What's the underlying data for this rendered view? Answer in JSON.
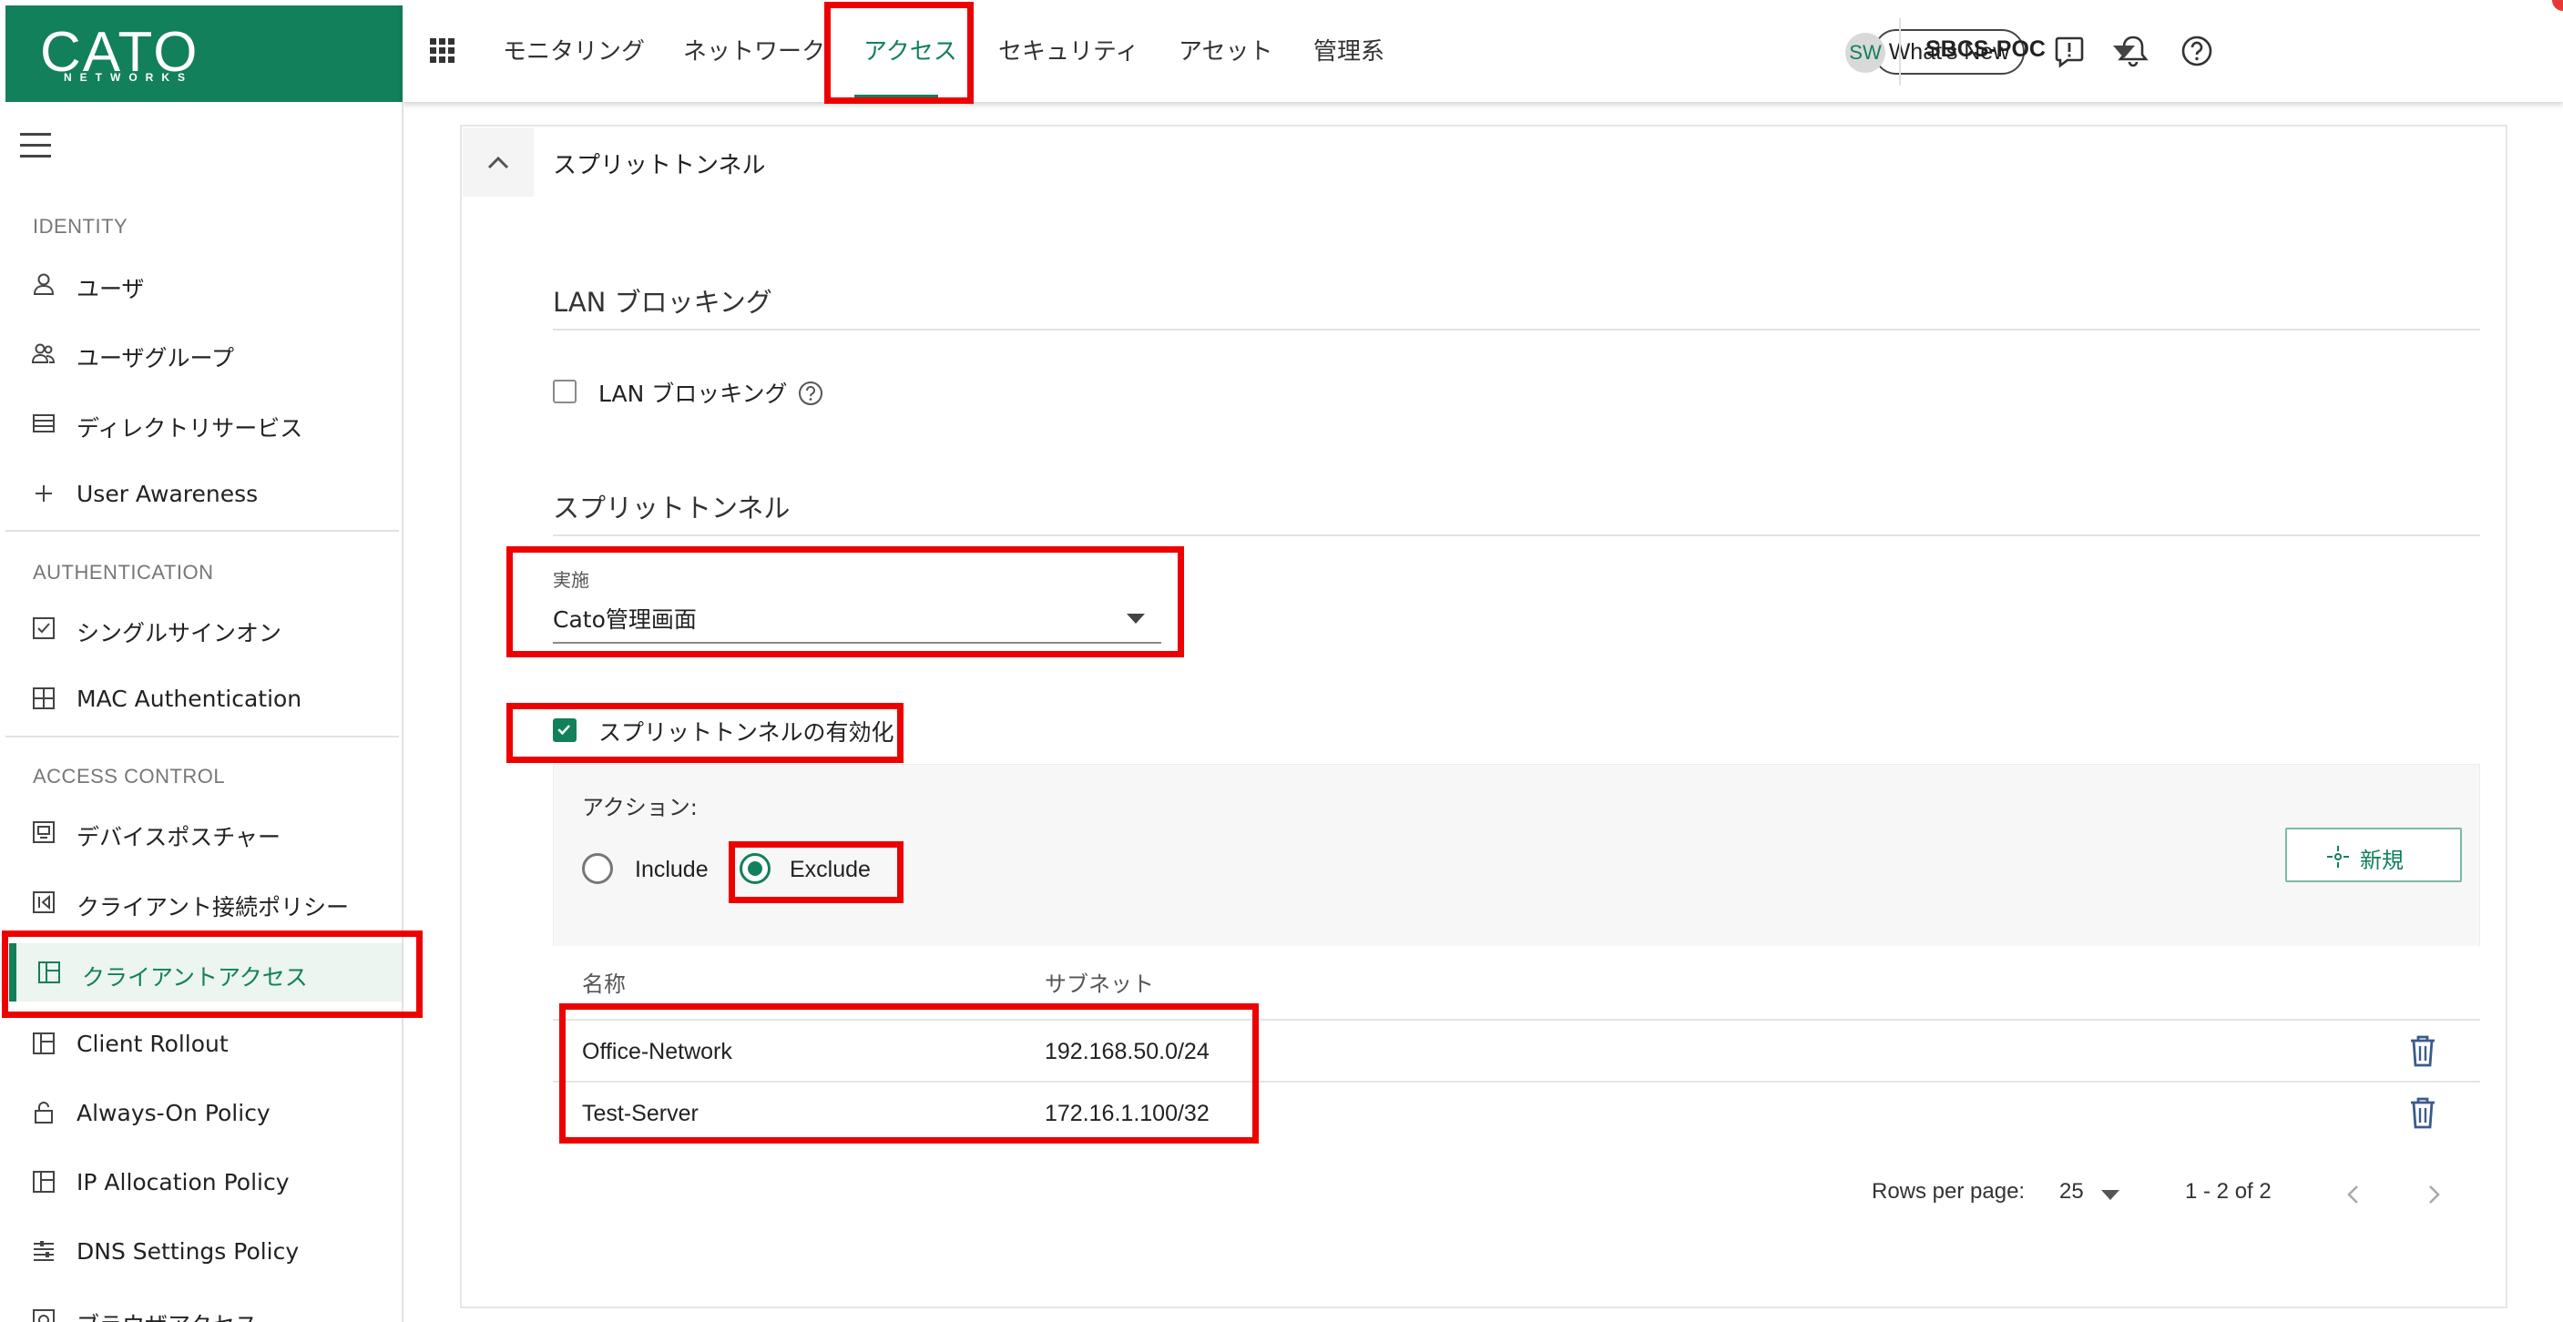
{
  "logo": {
    "text": "CATO",
    "subtext": "NETWORKS"
  },
  "nav": {
    "items": [
      "モニタリング",
      "ネットワーク",
      "アクセス",
      "セキュリティ",
      "アセット",
      "管理系"
    ],
    "active": "アクセス"
  },
  "header": {
    "whats_new": "What's New",
    "avatar_initials": "SW",
    "tenant": "SBCS-POC"
  },
  "sidebar": {
    "sections": [
      {
        "title": "IDENTITY",
        "items": [
          {
            "label": "ユーザ",
            "icon": "user-icon"
          },
          {
            "label": "ユーザグループ",
            "icon": "users-icon"
          },
          {
            "label": "ディレクトリサービス",
            "icon": "directory-icon"
          },
          {
            "label": "User Awareness",
            "icon": "plus-icon"
          }
        ]
      },
      {
        "title": "AUTHENTICATION",
        "items": [
          {
            "label": "シングルサインオン",
            "icon": "checkbox-icon"
          },
          {
            "label": "MAC Authentication",
            "icon": "grid-icon"
          }
        ]
      },
      {
        "title": "ACCESS CONTROL",
        "items": [
          {
            "label": "デバイスポスチャー",
            "icon": "device-icon"
          },
          {
            "label": "クライアント接続ポリシー",
            "icon": "connect-icon"
          },
          {
            "label": "クライアントアクセス",
            "icon": "layout-icon",
            "active": true
          },
          {
            "label": "Client Rollout",
            "icon": "layout-icon"
          },
          {
            "label": "Always-On Policy",
            "icon": "lock-icon"
          },
          {
            "label": "IP Allocation Policy",
            "icon": "layout-icon"
          },
          {
            "label": "DNS Settings Policy",
            "icon": "dns-icon"
          },
          {
            "label": "ブラウザアクセス",
            "icon": "browser-icon"
          }
        ]
      }
    ]
  },
  "card": {
    "title": "スプリットトンネル",
    "lan_section_title": "LAN ブロッキング",
    "lan_checkbox_label": "LAN ブロッキング",
    "lan_checked": false,
    "split_section_title": "スプリットトンネル",
    "select": {
      "label": "実施",
      "value": "Cato管理画面"
    },
    "enable_checkbox_label": "スプリットトンネルの有効化",
    "enable_checked": true,
    "action_label": "アクション:",
    "radio": {
      "include": "Include",
      "exclude": "Exclude",
      "selected": "Exclude"
    },
    "new_button": "新規",
    "table": {
      "columns": [
        "名称",
        "サブネット"
      ],
      "rows": [
        {
          "name": "Office-Network",
          "subnet": "192.168.50.0/24"
        },
        {
          "name": "Test-Server",
          "subnet": "172.16.1.100/32"
        }
      ]
    },
    "pager": {
      "rows_per_page_label": "Rows per page:",
      "rows_per_page": "25",
      "range": "1 - 2 of 2"
    }
  },
  "colors": {
    "brand": "#12805a",
    "annotation": "#ee0000"
  }
}
